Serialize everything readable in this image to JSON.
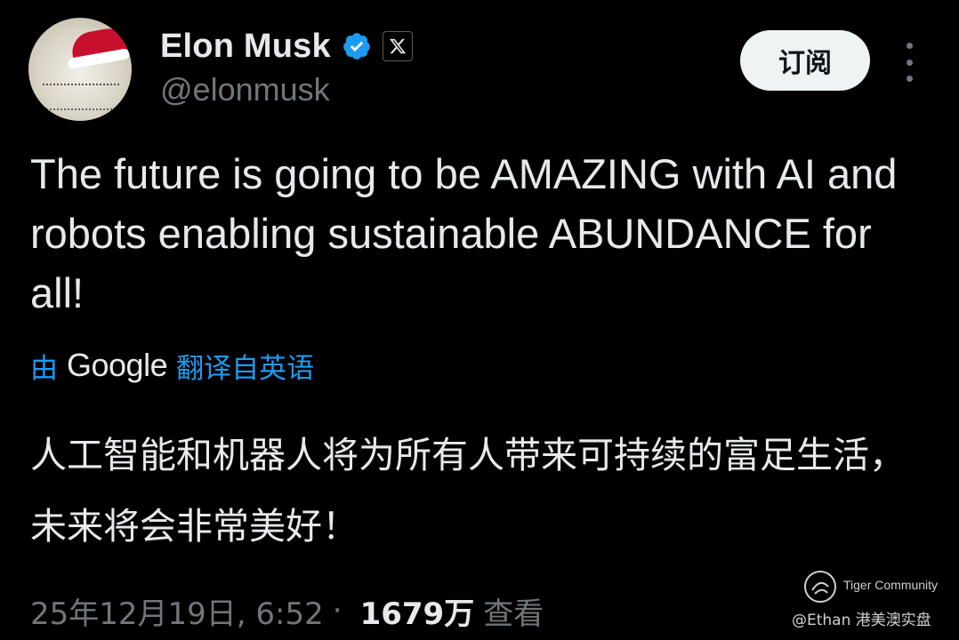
{
  "author": {
    "name": "Elon Musk",
    "handle": "@elonmusk",
    "verified_color": "#1d9bf0",
    "affiliation_icon": "x-logo-icon"
  },
  "actions": {
    "subscribe_label": "订阅",
    "more_icon": "more-vertical-icon"
  },
  "tweet": {
    "text": "The future is going to be AMAZING with AI and robots enabling sustainable ABUNDANCE for all!",
    "translate_prefix": "由",
    "translate_provider": "Google",
    "translate_suffix": "翻译自英语",
    "translated_text": "人工智能和机器人将为所有人带来可持续的富足生活，未来将会非常美好！"
  },
  "meta": {
    "timestamp": "25年12月19日, 6:52",
    "separator": "·",
    "views_count": "1679万",
    "views_label": "查看"
  },
  "watermark": {
    "brand": "Tiger Community",
    "user": "@Ethan 港美澳实盘"
  }
}
